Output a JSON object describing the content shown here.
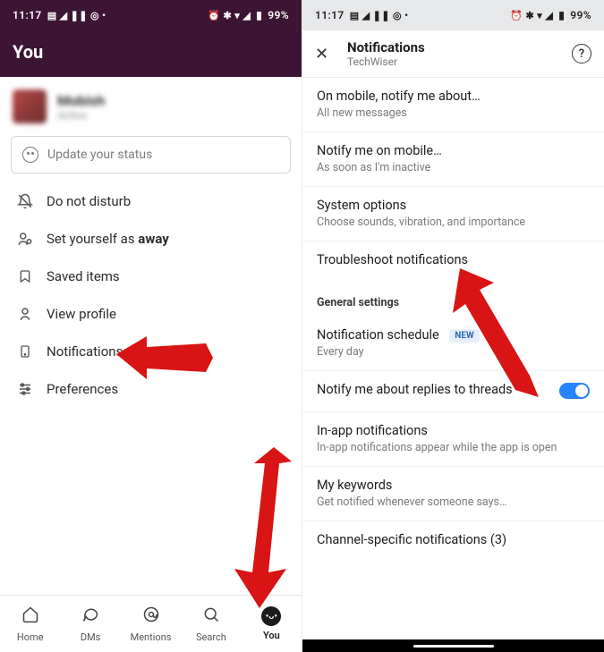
{
  "status_bar": {
    "time": "11:17",
    "battery": "99%"
  },
  "left": {
    "header_title": "You",
    "profile": {
      "name": "Mobish",
      "sub": "Active"
    },
    "status_placeholder": "Update your status",
    "menu": {
      "dnd": "Do not disturb",
      "away_prefix": "Set yourself as ",
      "away_bold": "away",
      "saved": "Saved items",
      "view_profile": "View profile",
      "notifications": "Notifications",
      "preferences": "Preferences"
    },
    "tabs": {
      "home": "Home",
      "dms": "DMs",
      "mentions": "Mentions",
      "search": "Search",
      "you": "You"
    }
  },
  "right": {
    "title": "Notifications",
    "subtitle": "TechWiser",
    "items": {
      "on_mobile": {
        "title": "On mobile, notify me about…",
        "sub": "All new messages"
      },
      "notify_mobile": {
        "title": "Notify me on mobile…",
        "sub": "As soon as I'm inactive"
      },
      "system_options": {
        "title": "System options",
        "sub": "Choose sounds, vibration, and importance"
      },
      "troubleshoot": {
        "title": "Troubleshoot notifications"
      },
      "section_general": "General settings",
      "schedule": {
        "title": "Notification schedule",
        "badge": "NEW",
        "sub": "Every day"
      },
      "threads": {
        "title": "Notify me about replies to threads"
      },
      "inapp": {
        "title": "In-app notifications",
        "sub": "In-app notifications appear while the app is open"
      },
      "keywords": {
        "title": "My keywords",
        "sub": "Get notified whenever someone says…"
      },
      "channel": {
        "title": "Channel-specific notifications (3)"
      }
    }
  }
}
